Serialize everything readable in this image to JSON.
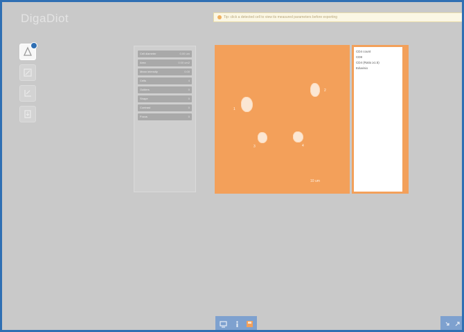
{
  "app": {
    "logo": "DigaDiot",
    "notice": "Tip: click a detected cell to view its measured parameters before exporting"
  },
  "toolbox": {
    "tools": [
      {
        "name": "cell-tool-icon",
        "active": true
      },
      {
        "name": "ruler-tool-icon",
        "active": false
      },
      {
        "name": "crop-tool-icon",
        "active": false
      },
      {
        "name": "export-tool-icon",
        "active": false
      }
    ]
  },
  "parameters": [
    {
      "label": "Cell diameter",
      "value": "0.00 um"
    },
    {
      "label": "Area",
      "value": "0.00 um2"
    },
    {
      "label": "Mean intensity",
      "value": "0.00"
    },
    {
      "label": "Cells",
      "value": "4"
    },
    {
      "label": "Outliers",
      "value": "0"
    },
    {
      "label": "Shape",
      "value": "0"
    },
    {
      "label": "Contrast",
      "value": "0"
    },
    {
      "label": "Focus",
      "value": "0"
    }
  ],
  "viewer": {
    "scale_label": "10 um",
    "cells": [
      {
        "label": "1"
      },
      {
        "label": "2"
      },
      {
        "label": "3"
      },
      {
        "label": "4"
      }
    ]
  },
  "results": {
    "lines": [
      "CD4 count",
      "CD8",
      "CD4 (Ratio ≥1.5)",
      "Eduvisio"
    ]
  },
  "colors": {
    "frame_border": "#2f6fb3",
    "background": "#c9c9c9",
    "viewer_accent": "#f3a05a",
    "bar_blue": "#7ea1cf"
  }
}
